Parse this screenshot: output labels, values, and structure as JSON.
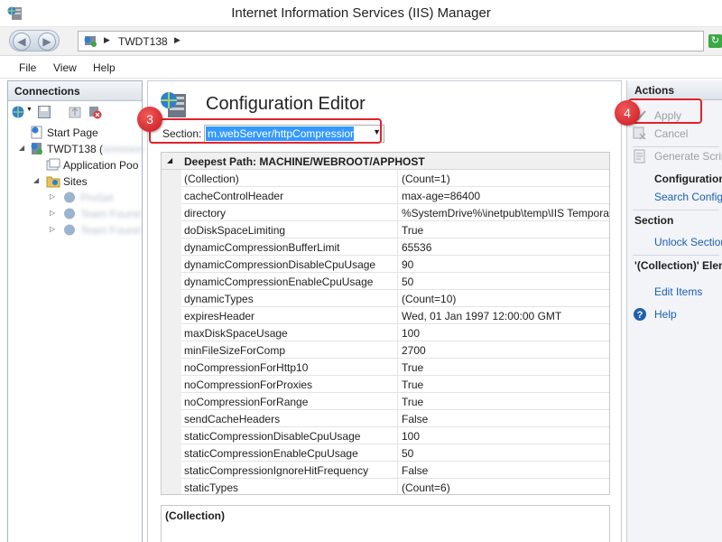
{
  "window": {
    "title": "Internet Information Services (IIS) Manager"
  },
  "address": {
    "server": "TWDT138"
  },
  "menu": {
    "items": [
      "File",
      "View",
      "Help"
    ]
  },
  "connections": {
    "title": "Connections",
    "tree": {
      "start_page": "Start Page",
      "server": "TWDT138 (",
      "server_suffix": "nnnnnnn",
      "app_pools": "Application Poo",
      "sites": "Sites",
      "site1": "ProSet",
      "site2": "Team Found",
      "site3": "Team Found"
    }
  },
  "editor": {
    "title": "Configuration Editor",
    "section_label": "Section:",
    "section_value": "m.webServer/httpCompression",
    "deepest_path": "Deepest Path: MACHINE/WEBROOT/APPHOST",
    "rows": [
      {
        "key": "(Collection)",
        "value": "(Count=1)"
      },
      {
        "key": "cacheControlHeader",
        "value": "max-age=86400"
      },
      {
        "key": "directory",
        "value": "%SystemDrive%\\inetpub\\temp\\IIS Tempora"
      },
      {
        "key": "doDiskSpaceLimiting",
        "value": "True"
      },
      {
        "key": "dynamicCompressionBufferLimit",
        "value": "65536"
      },
      {
        "key": "dynamicCompressionDisableCpuUsage",
        "value": "90"
      },
      {
        "key": "dynamicCompressionEnableCpuUsage",
        "value": "50"
      },
      {
        "key": "dynamicTypes",
        "value": "(Count=10)"
      },
      {
        "key": "expiresHeader",
        "value": "Wed, 01 Jan 1997 12:00:00 GMT"
      },
      {
        "key": "maxDiskSpaceUsage",
        "value": "100"
      },
      {
        "key": "minFileSizeForComp",
        "value": "2700"
      },
      {
        "key": "noCompressionForHttp10",
        "value": "True"
      },
      {
        "key": "noCompressionForProxies",
        "value": "True"
      },
      {
        "key": "noCompressionForRange",
        "value": "True"
      },
      {
        "key": "sendCacheHeaders",
        "value": "False"
      },
      {
        "key": "staticCompressionDisableCpuUsage",
        "value": "100"
      },
      {
        "key": "staticCompressionEnableCpuUsage",
        "value": "50"
      },
      {
        "key": "staticCompressionIgnoreHitFrequency",
        "value": "False"
      },
      {
        "key": "staticTypes",
        "value": "(Count=6)"
      }
    ],
    "description_title": "(Collection)"
  },
  "actions": {
    "title": "Actions",
    "apply": "Apply",
    "cancel": "Cancel",
    "generate_script": "Generate Script",
    "configuration": "Configuration",
    "search_configuration": "Search Configuration",
    "section_group": "Section",
    "unlock_section": "Unlock Section",
    "collection_element": "'(Collection)' Element",
    "edit_items": "Edit Items",
    "help": "Help"
  },
  "callouts": {
    "step3": "3",
    "step4": "4"
  },
  "colors": {
    "callout_red": "#e0232b",
    "selection_blue": "#3399ff",
    "link_blue": "#1a5fb4"
  }
}
